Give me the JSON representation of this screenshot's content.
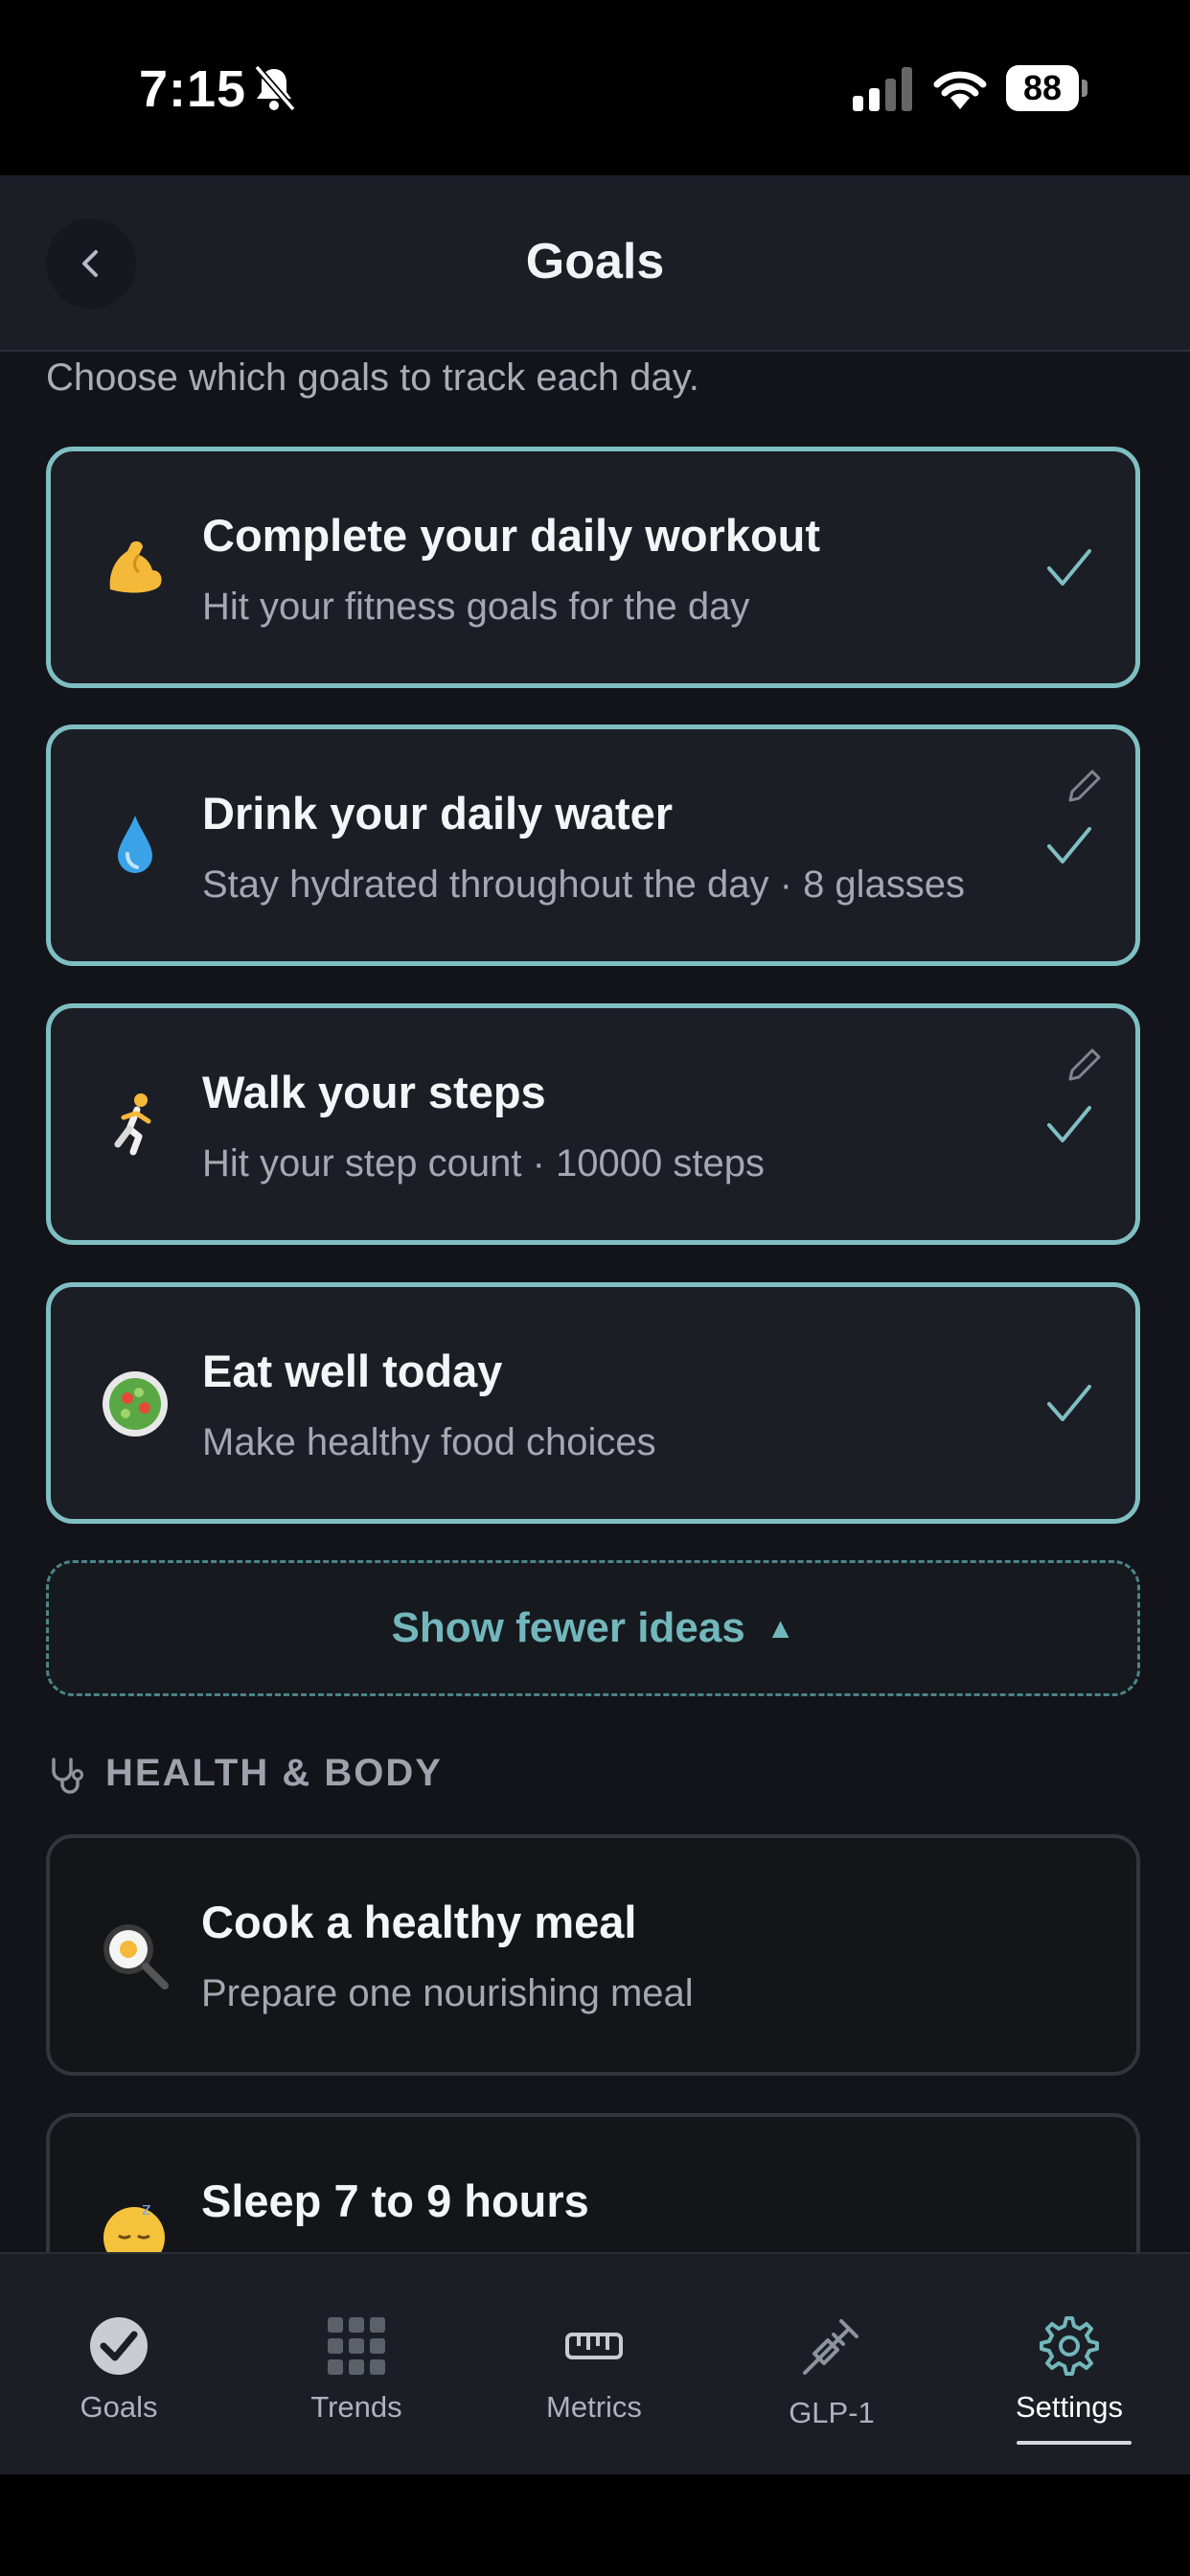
{
  "status": {
    "time": "7:15",
    "battery": "88"
  },
  "header": {
    "title": "Goals"
  },
  "subtitle": "Choose which goals to track each day.",
  "selected_goals": [
    {
      "title": "Complete your daily workout",
      "description": "Hit your fitness goals for the day",
      "emoji": "flexed-biceps",
      "selected": true,
      "editable": false
    },
    {
      "title": "Drink your daily water",
      "description": "Stay hydrated throughout the day · 8 glasses",
      "emoji": "droplet",
      "selected": true,
      "editable": true
    },
    {
      "title": "Walk your steps",
      "description": "Hit your step count · 10000 steps",
      "emoji": "person-running",
      "selected": true,
      "editable": true
    },
    {
      "title": "Eat well today",
      "description": "Make healthy food choices",
      "emoji": "green-salad",
      "selected": true,
      "editable": false
    }
  ],
  "show_fewer": {
    "label": "Show fewer ideas",
    "arrow": "▲"
  },
  "section": {
    "title": "HEALTH & BODY",
    "icon": "stethoscope-icon"
  },
  "suggested_goals": [
    {
      "title": "Cook a healthy meal",
      "description": "Prepare one nourishing meal",
      "emoji": "cooking-pan",
      "selected": false
    },
    {
      "title": "Sleep 7 to 9 hours",
      "description": "",
      "emoji": "sleeping-face",
      "selected": false
    }
  ],
  "tabs": [
    {
      "label": "Goals",
      "icon": "goals-check-icon",
      "active": false
    },
    {
      "label": "Trends",
      "icon": "grid-icon",
      "active": false
    },
    {
      "label": "Metrics",
      "icon": "ruler-icon",
      "active": false
    },
    {
      "label": "GLP-1",
      "icon": "syringe-icon",
      "active": false
    },
    {
      "label": "Settings",
      "icon": "gear-icon",
      "active": true
    }
  ],
  "colors": {
    "accent": "#7fbfc3",
    "background": "#121419",
    "card": "#1b1e25"
  }
}
